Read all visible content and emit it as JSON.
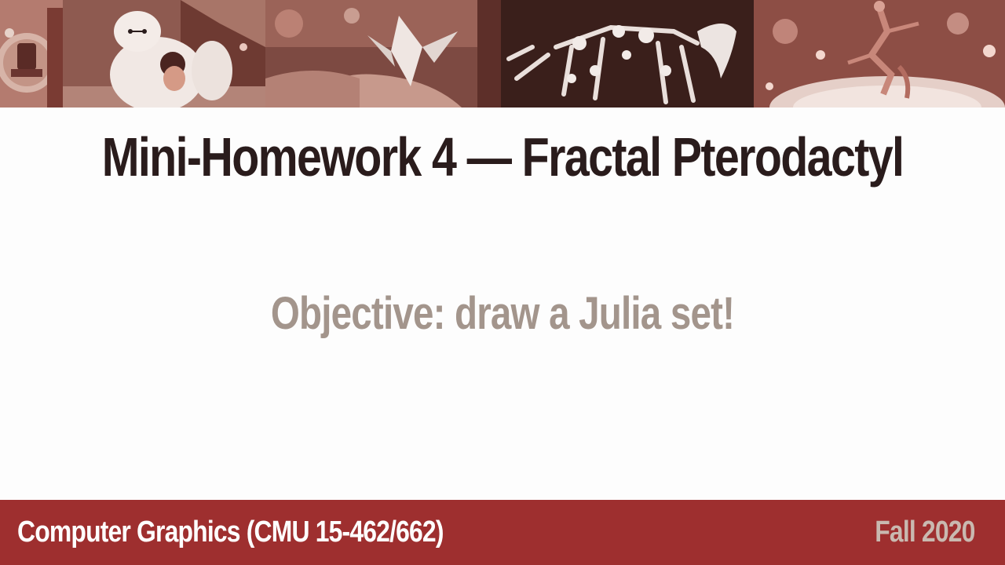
{
  "banner": {
    "panels": [
      {
        "image": "robot-toy-illustration"
      },
      {
        "image": "baymax-figure-hugging-child"
      },
      {
        "image": "origami-crane-on-hand"
      },
      {
        "image": "mechanical-pterodactyl-skeleton"
      },
      {
        "image": "dancer-on-glowing-stage"
      }
    ]
  },
  "slide": {
    "title": "Mini-Homework 4 — Fractal Pterodactyl",
    "objective": "Objective: draw a Julia set!"
  },
  "footer": {
    "course": "Computer Graphics (CMU 15-462/662)",
    "term": "Fall 2020"
  },
  "colors": {
    "title": "#2a1c1c",
    "objective": "#a3958c",
    "footer_bg": "#9e2f2f",
    "footer_text": "#ffffff",
    "footer_term": "#c9b9b0"
  }
}
